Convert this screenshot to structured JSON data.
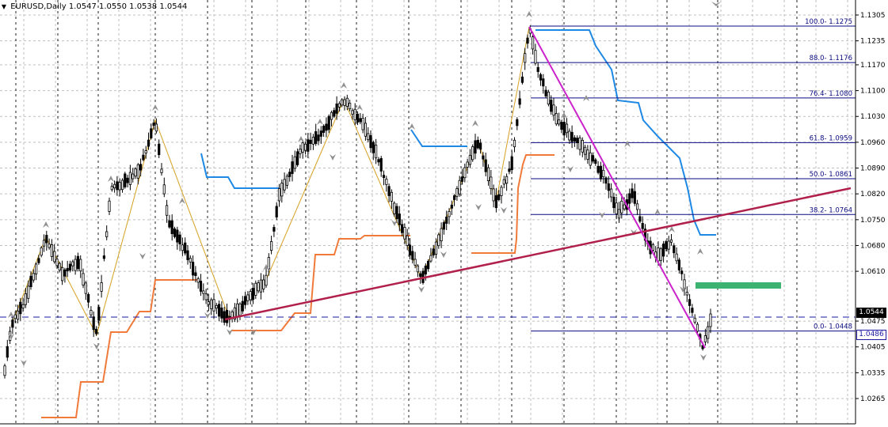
{
  "symbol_header": {
    "symbol_timeframe": "EURUSD,Daily",
    "ohlc": "1.0547 1.0550 1.0538 1.0544"
  },
  "price_axis": {
    "ticks": [
      "1.1305",
      "1.1235",
      "1.1170",
      "1.1100",
      "1.1030",
      "1.0960",
      "1.0890",
      "1.0820",
      "1.0750",
      "1.0680",
      "1.0610",
      "1.0475",
      "1.0405",
      "1.0335",
      "1.0265"
    ],
    "current_price_label": "1.0544",
    "level_price_label": "1.0486"
  },
  "fibonacci": {
    "levels": [
      {
        "label": "100.0- 1.1275",
        "price": 1.1275
      },
      {
        "label": "88.0- 1.1176",
        "price": 1.1176
      },
      {
        "label": "76.4- 1.1080",
        "price": 1.108
      },
      {
        "label": "61.8- 1.0959",
        "price": 1.0959
      },
      {
        "label": "50.0- 1.0861",
        "price": 1.0861
      },
      {
        "label": "38.2- 1.0764",
        "price": 1.0764
      },
      {
        "label": "0.0- 1.0448",
        "price": 1.0448
      }
    ]
  },
  "colors": {
    "background": "#ffffff",
    "candles": "#000000",
    "grid": "#c0c0c0",
    "fib_lines": "#0a0a80",
    "horizontal_level": "#1a1aa0",
    "trendline": "#b0204a",
    "zigzag": "#d4a020",
    "down_trendline": "#cc22cc",
    "blue_stop_line": "#1e88e5",
    "orange_stop_line": "#f07a3a",
    "target_zone": "#3cb371",
    "fractal_arrows": "#909090"
  },
  "chart_data": {
    "type": "candlestick",
    "symbol": "EURUSD",
    "timeframe": "Daily",
    "y_range": [
      1.0245,
      1.1325
    ],
    "current_price": 1.0544,
    "horizontal_level": 1.0486,
    "indicators": [
      "Fibonacci retracement",
      "ZigZag",
      "Fractals",
      "Trend lines",
      "Stop lines"
    ]
  }
}
